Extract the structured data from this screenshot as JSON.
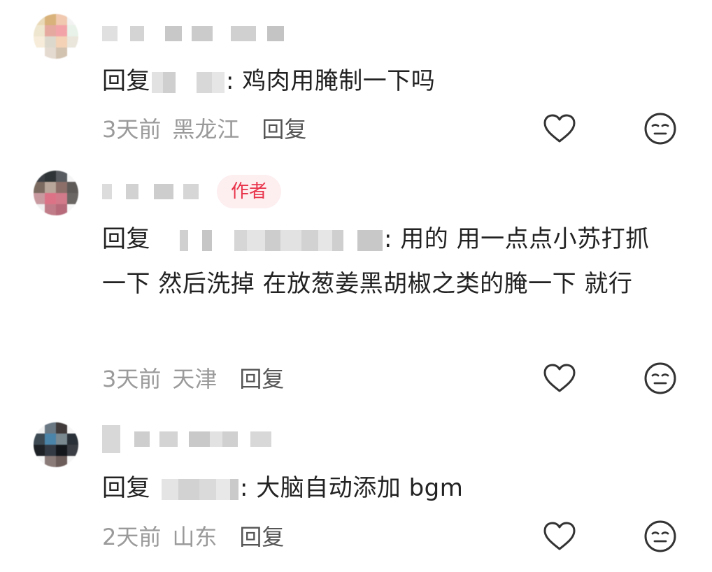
{
  "comments": [
    {
      "reply_prefix": "回复",
      "text": ": 鸡肉用腌制一下吗",
      "time": "3天前",
      "location": "黑龙江",
      "reply_label": "回复",
      "badge": "",
      "icons": {
        "like": "heart-outline-icon",
        "dislike": "meh-face-icon"
      }
    },
    {
      "reply_prefix": "回复",
      "text": ": 用的 用一点点小苏打抓一下 然后洗掉 在放葱姜黑胡椒之类的腌一下 就行",
      "time": "3天前",
      "location": "天津",
      "reply_label": "回复",
      "badge": "作者",
      "icons": {
        "like": "heart-outline-icon",
        "dislike": "meh-face-icon"
      }
    },
    {
      "reply_prefix": "回复",
      "text": ": 大脑自动添加 bgm",
      "time": "2天前",
      "location": "山东",
      "reply_label": "回复",
      "badge": "",
      "icons": {
        "like": "heart-outline-icon",
        "dislike": "meh-face-icon"
      }
    }
  ],
  "colors": {
    "badge_text": "#e8334a",
    "badge_bg": "#fdeef0",
    "meta_text": "#9a9a9a",
    "body_text": "#222222"
  }
}
